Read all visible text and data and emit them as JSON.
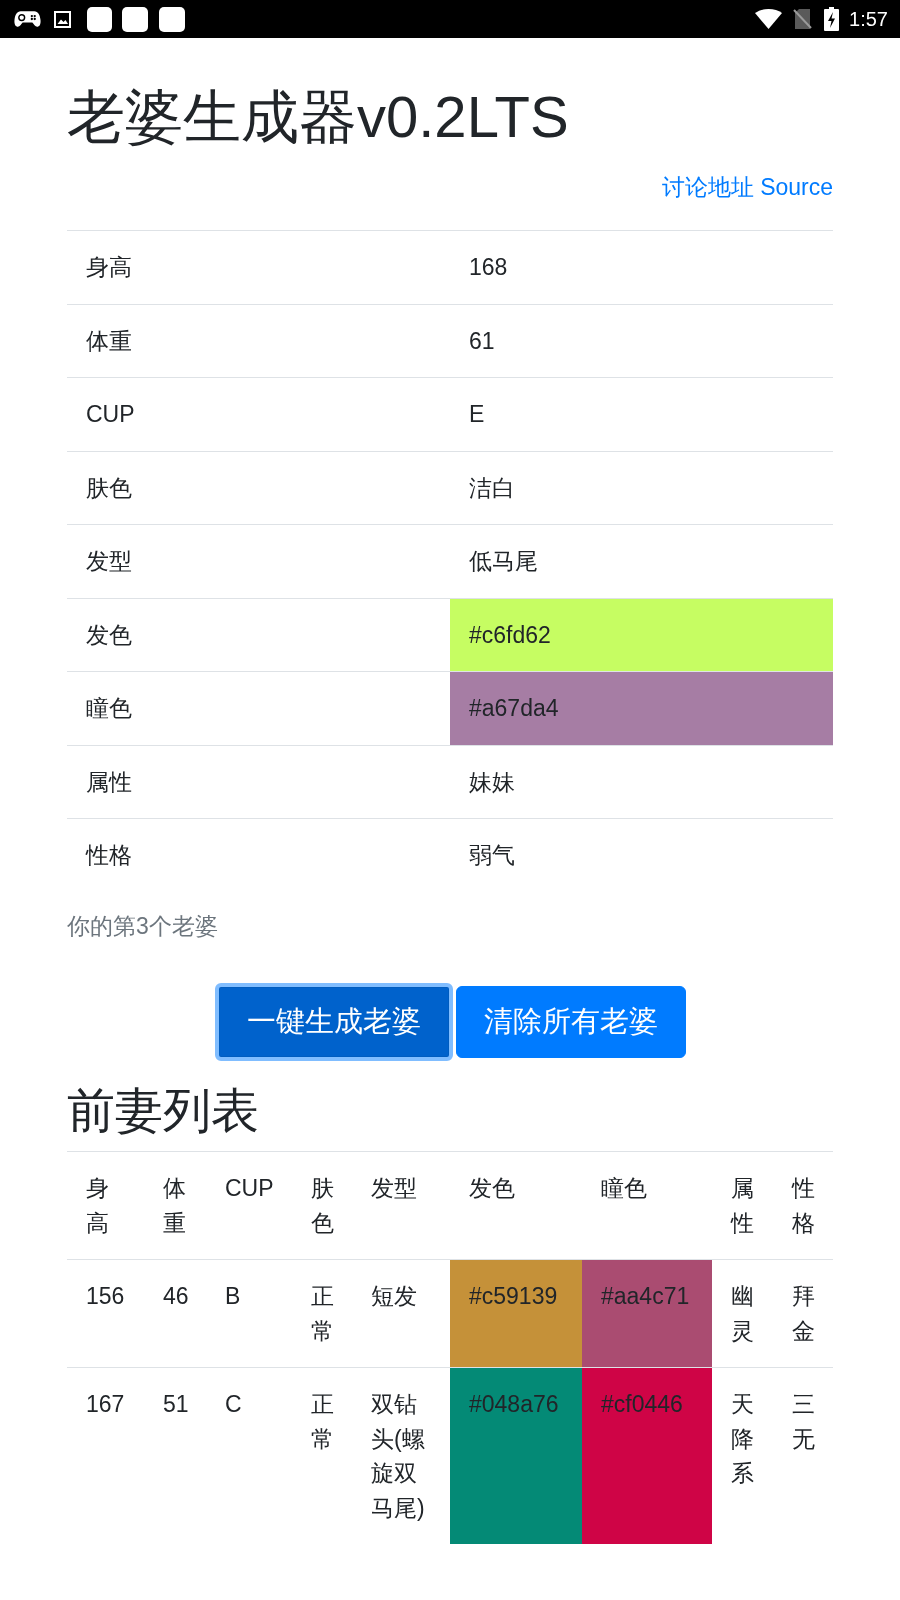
{
  "status_bar": {
    "time": "1:57"
  },
  "title": "老婆生成器v0.2LTS",
  "links": [
    {
      "label": "讨论地址"
    },
    {
      "label": "Source"
    }
  ],
  "current": {
    "rows": [
      {
        "label": "身高",
        "value": "168"
      },
      {
        "label": "体重",
        "value": "61"
      },
      {
        "label": "CUP",
        "value": "E"
      },
      {
        "label": "肤色",
        "value": "洁白"
      },
      {
        "label": "发型",
        "value": "低马尾"
      },
      {
        "label": "发色",
        "value": "#c6fd62",
        "color": "#c6fd62"
      },
      {
        "label": "瞳色",
        "value": "#a67da4",
        "color": "#a67da4"
      },
      {
        "label": "属性",
        "value": "妹妹"
      },
      {
        "label": "性格",
        "value": "弱气"
      }
    ]
  },
  "count_note": "你的第3个老婆",
  "buttons": [
    {
      "label": "一键生成老婆",
      "focused": true
    },
    {
      "label": "清除所有老婆",
      "focused": false
    }
  ],
  "history": {
    "title": "前妻列表",
    "columns": [
      "身高",
      "体重",
      "CUP",
      "肤色",
      "发型",
      "发色",
      "瞳色",
      "属性",
      "性格"
    ],
    "rows": [
      {
        "cells": [
          {
            "text": "156"
          },
          {
            "text": "46"
          },
          {
            "text": "B"
          },
          {
            "text": "正常"
          },
          {
            "text": "短发"
          },
          {
            "text": "#c59139",
            "color": "#c59139"
          },
          {
            "text": "#aa4c71",
            "color": "#aa4c71"
          },
          {
            "text": "幽灵"
          },
          {
            "text": "拜金"
          }
        ]
      },
      {
        "cells": [
          {
            "text": "167"
          },
          {
            "text": "51"
          },
          {
            "text": "C"
          },
          {
            "text": "正常"
          },
          {
            "text": "双钻头(螺旋双马尾)"
          },
          {
            "text": "#048a76",
            "color": "#048a76"
          },
          {
            "text": "#cf0446",
            "color": "#cf0446"
          },
          {
            "text": "天降系"
          },
          {
            "text": "三无"
          }
        ]
      }
    ]
  }
}
